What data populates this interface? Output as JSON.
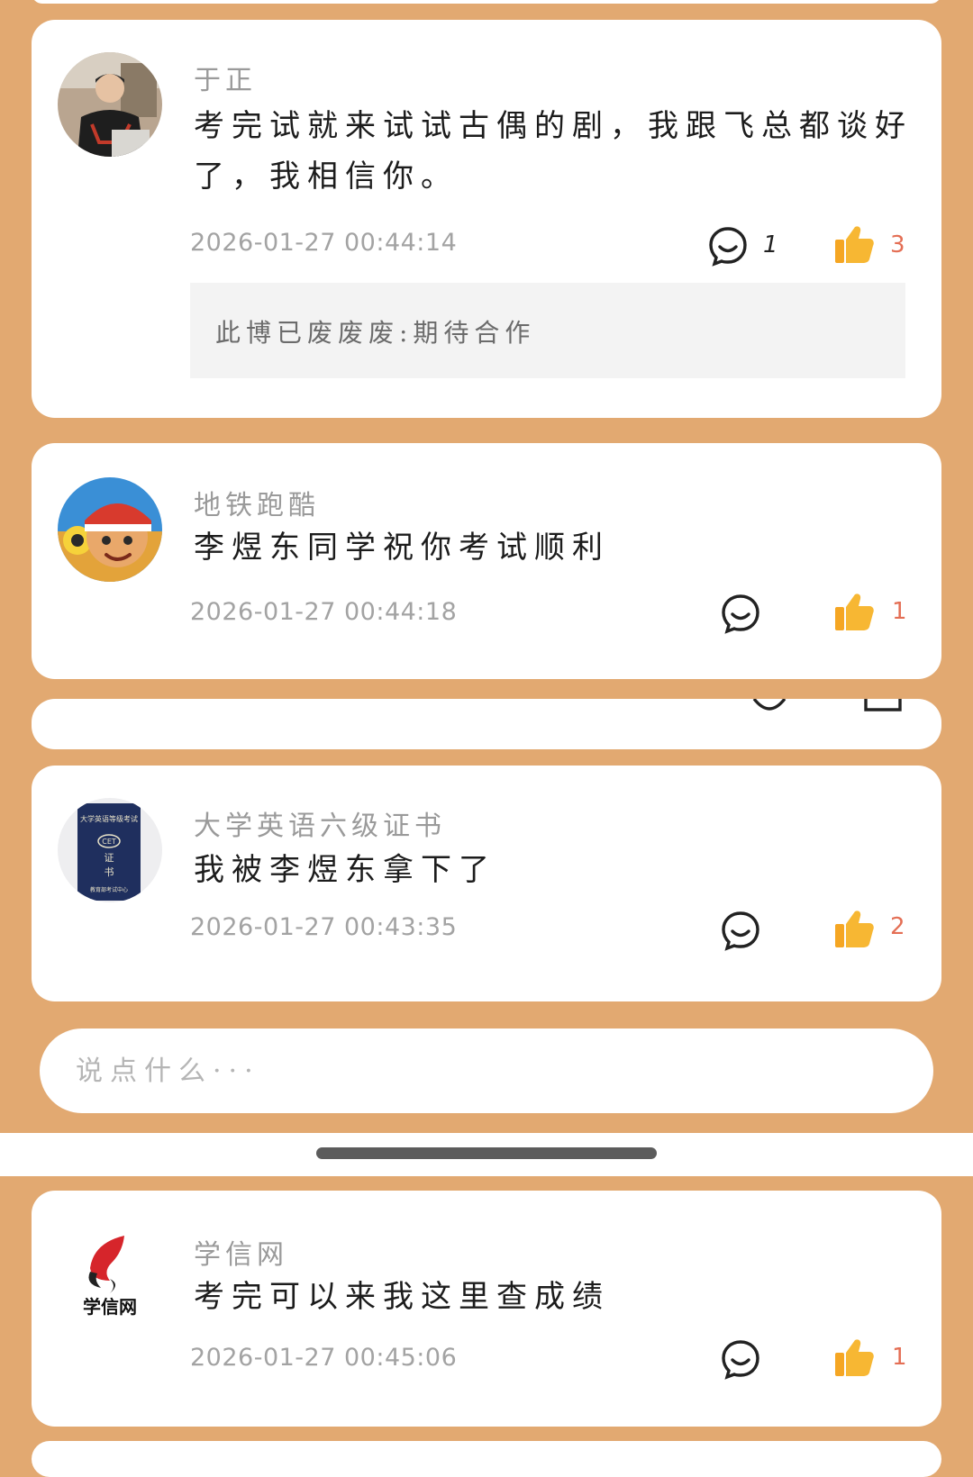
{
  "comments": [
    {
      "username": "于正",
      "text": "考完试就来试试古偶的剧，我跟飞总都谈好了，我相信你。",
      "time": "2026-01-27 00:44:14",
      "reply_count": "1",
      "like_count": "3",
      "reply_preview": "此博已废废废:期待合作"
    },
    {
      "username": "地铁跑酷",
      "text": "李煜东同学祝你考试顺利",
      "time": "2026-01-27 00:44:18",
      "reply_count": "",
      "like_count": "1"
    },
    {
      "username": "大学英语六级证书",
      "text": "我被李煜东拿下了",
      "time": "2026-01-27 00:43:35",
      "reply_count": "",
      "like_count": "2",
      "avatar_text": [
        "大学英语等级考试",
        "CET",
        "证",
        "书",
        "教育部考试中心"
      ]
    },
    {
      "username": "学信网",
      "text": "考完可以来我这里查成绩",
      "time": "2026-01-27 00:45:06",
      "reply_count": "",
      "like_count": "1",
      "avatar_text": "学信网"
    }
  ],
  "input": {
    "placeholder": "说点什么···",
    "value": ""
  },
  "colors": {
    "background": "#e2a971",
    "like": "#f5b22c",
    "count_accent": "#e46f55"
  },
  "icons": {
    "reply": "comment-bubble-icon",
    "like": "thumbs-up-icon"
  }
}
